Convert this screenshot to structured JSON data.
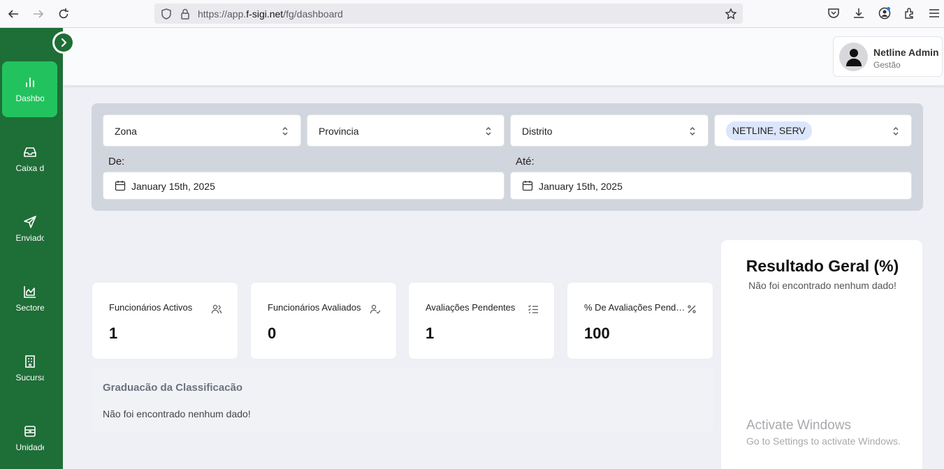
{
  "browser": {
    "url_prefix": "https://app.",
    "url_host": "f-sigi.net",
    "url_path": "/fg/dashboard"
  },
  "sidebar": {
    "items": [
      {
        "label": "Dashbo",
        "icon": "bar-chart-icon",
        "active": true
      },
      {
        "label": "Caixa d",
        "icon": "inbox-icon",
        "active": false
      },
      {
        "label": "Enviado",
        "icon": "send-icon",
        "active": false
      },
      {
        "label": "Sectore",
        "icon": "area-chart-icon",
        "active": false
      },
      {
        "label": "Sucursa",
        "icon": "building-icon",
        "active": false
      },
      {
        "label": "Unidade",
        "icon": "archive-icon",
        "active": false
      }
    ]
  },
  "user": {
    "name": "Netline Admin",
    "role": "Gestão"
  },
  "filters": {
    "zona": "Zona",
    "provincia": "Provincia",
    "distrito": "Distrito",
    "empresa_chip": "NETLINE, SERV",
    "de_label": "De:",
    "ate_label": "Até:",
    "de_value": "January 15th, 2025",
    "ate_value": "January 15th, 2025"
  },
  "stats": [
    {
      "title": "Funcionários Activos",
      "value": "1",
      "icon": "users-icon"
    },
    {
      "title": "Funcionários Avaliados",
      "value": "0",
      "icon": "user-check-icon"
    },
    {
      "title": "Avaliações Pendentes",
      "value": "1",
      "icon": "list-check-icon"
    },
    {
      "title": "% De Avaliações Pendentes",
      "value": "100",
      "icon": "percent-icon"
    }
  ],
  "graduacao": {
    "title": "Graduacão da Classificacão",
    "empty": "Não foi encontrado nenhum dado!"
  },
  "resultado": {
    "title": "Resultado Geral (%)",
    "empty": "Não foi encontrado nenhum dado!"
  },
  "watermark": {
    "line1": "Activate Windows",
    "line2": "Go to Settings to activate Windows."
  }
}
